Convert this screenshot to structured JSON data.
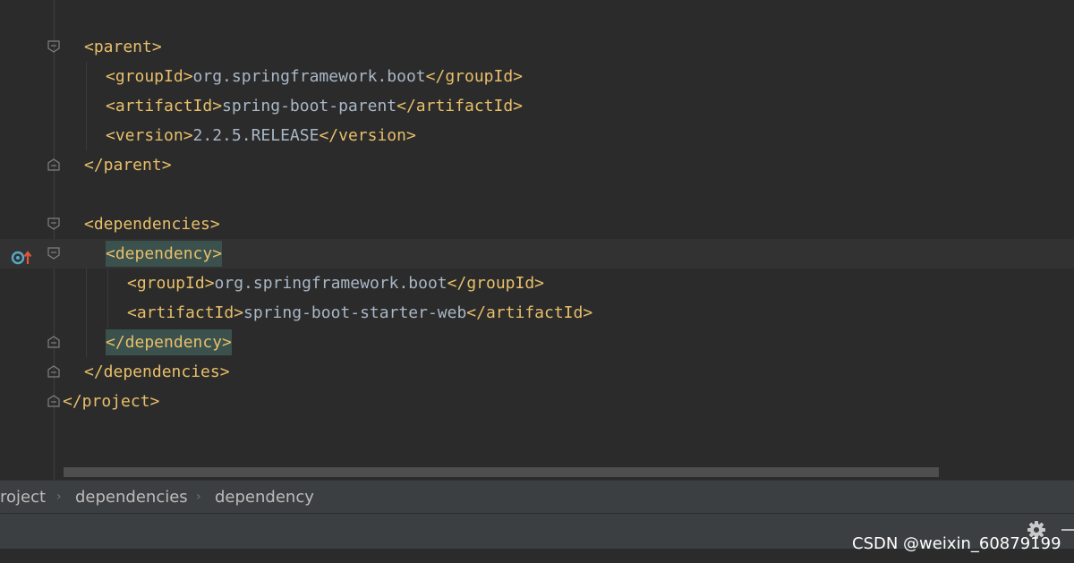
{
  "editor": {
    "lines": [
      {
        "indent": 1,
        "segments": [
          {
            "t": "tag",
            "v": "<parent>"
          }
        ],
        "fold": "open"
      },
      {
        "indent": 2,
        "segments": [
          {
            "t": "tag",
            "v": "<groupId>"
          },
          {
            "t": "text",
            "v": "org.springframework.boot"
          },
          {
            "t": "tag",
            "v": "</groupId>"
          }
        ]
      },
      {
        "indent": 2,
        "segments": [
          {
            "t": "tag",
            "v": "<artifactId>"
          },
          {
            "t": "text",
            "v": "spring-boot-parent"
          },
          {
            "t": "tag",
            "v": "</artifactId>"
          }
        ]
      },
      {
        "indent": 2,
        "segments": [
          {
            "t": "tag",
            "v": "<version>"
          },
          {
            "t": "text",
            "v": "2.2.5.RELEASE"
          },
          {
            "t": "tag",
            "v": "</version>"
          }
        ]
      },
      {
        "indent": 1,
        "segments": [
          {
            "t": "tag",
            "v": "</parent>"
          }
        ],
        "fold": "close"
      },
      {
        "indent": 0,
        "segments": []
      },
      {
        "indent": 1,
        "segments": [
          {
            "t": "tag",
            "v": "<dependencies>"
          }
        ],
        "fold": "open"
      },
      {
        "indent": 2,
        "segments": [
          {
            "t": "tag",
            "v": "<dependency>",
            "hl": true
          }
        ],
        "fold": "open",
        "caret": true,
        "marker": true
      },
      {
        "indent": 3,
        "segments": [
          {
            "t": "tag",
            "v": "<groupId>"
          },
          {
            "t": "text",
            "v": "org.springframework.boot"
          },
          {
            "t": "tag",
            "v": "</groupId>"
          }
        ]
      },
      {
        "indent": 3,
        "segments": [
          {
            "t": "tag",
            "v": "<artifactId>"
          },
          {
            "t": "text",
            "v": "spring-boot-starter-web"
          },
          {
            "t": "tag",
            "v": "</artifactId>"
          }
        ]
      },
      {
        "indent": 2,
        "segments": [
          {
            "t": "tag",
            "v": "</dependency>",
            "hl": true
          }
        ],
        "fold": "close"
      },
      {
        "indent": 1,
        "segments": [
          {
            "t": "tag",
            "v": "</dependencies>"
          }
        ],
        "fold": "close"
      },
      {
        "indent": 0,
        "segments": [
          {
            "t": "tag",
            "v": "</project>"
          }
        ],
        "fold": "close"
      }
    ]
  },
  "breadcrumb": {
    "items": [
      "roject",
      "dependencies",
      "dependency"
    ],
    "separator": "›"
  },
  "icons": {
    "gutter_marker": "maven-override-up-arrow-icon",
    "fold": "fold-marker-icon",
    "settings": "gear-icon",
    "minimize": "minimize-icon"
  },
  "colors": {
    "background": "#2b2b2b",
    "tag": "#e8bf6a",
    "text": "#a9b7c6",
    "tag_highlight": "#3b514d",
    "caret_row": "#323232",
    "breadcrumb_bar": "#3c3f41",
    "breadcrumb_text": "#bbbbbb"
  },
  "watermark": "CSDN @weixin_60879199"
}
